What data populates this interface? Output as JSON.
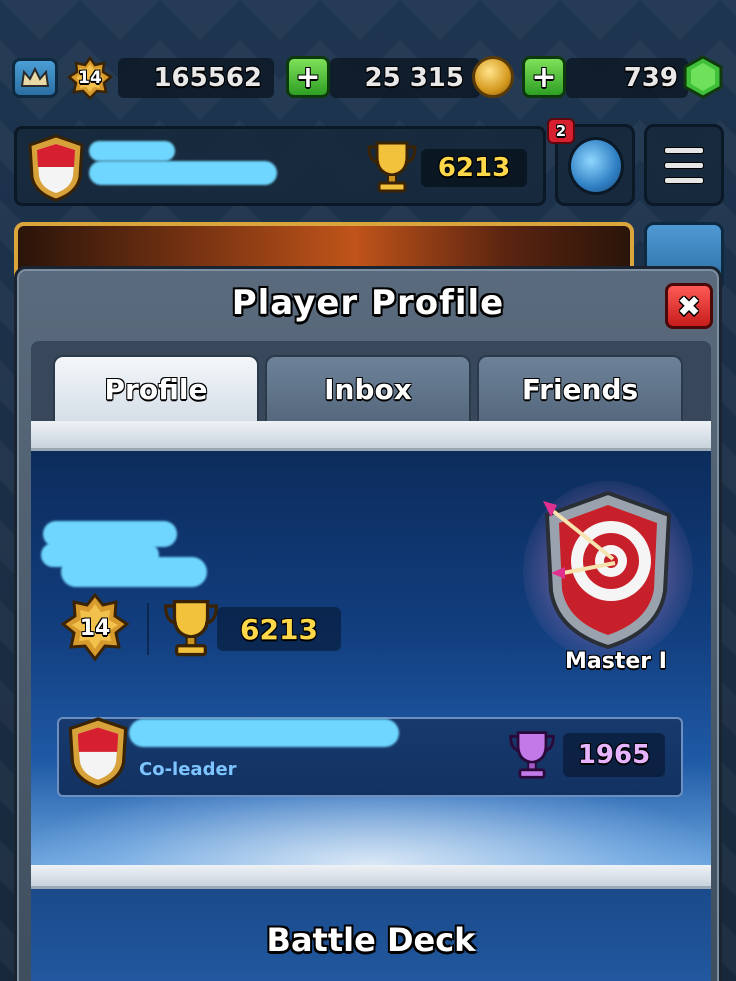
{
  "top_bar": {
    "king_level": "14",
    "experience": "165562",
    "gold": "25 315",
    "gems": "739"
  },
  "clan_row": {
    "trophies": "6213",
    "notification_count": "2"
  },
  "modal": {
    "title": "Player Profile",
    "close_symbol": "✖",
    "tabs": [
      {
        "label": "Profile",
        "active": true
      },
      {
        "label": "Inbox",
        "active": false
      },
      {
        "label": "Friends",
        "active": false
      }
    ]
  },
  "profile": {
    "king_level": "14",
    "trophies": "6213",
    "arena": "Master I",
    "clan": {
      "role": "Co-leader",
      "clan_trophies": "1965"
    }
  },
  "deck": {
    "title": "Battle Deck"
  },
  "colors": {
    "trophy_gold": "#ffd84a",
    "clan_trophy_purple": "#e7b5ff",
    "role_blue": "#7ec5ff",
    "close_red": "#d6202f",
    "plus_green": "#2e9f24"
  },
  "icons": [
    "crown-icon",
    "level-star-icon",
    "plus-icon",
    "gold-coin-icon",
    "gem-icon",
    "clan-shield-icon",
    "trophy-icon",
    "globe-icon",
    "menu-icon",
    "close-icon",
    "arena-target-icon",
    "clan-trophy-icon"
  ]
}
